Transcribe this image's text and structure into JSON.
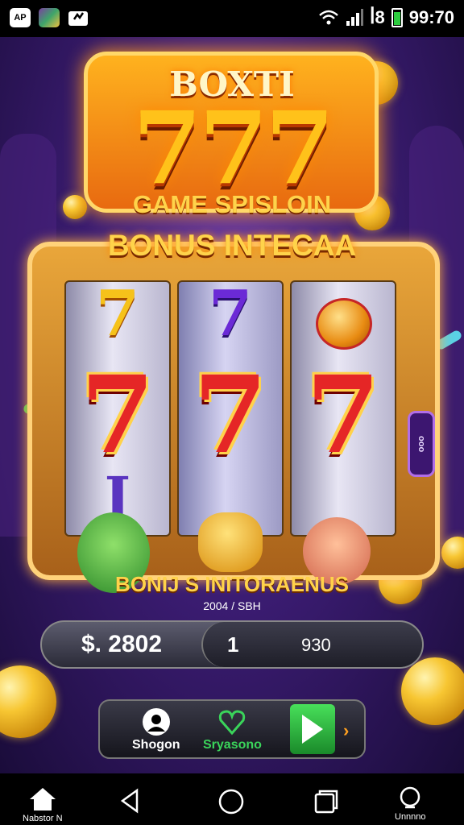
{
  "status_bar": {
    "badge": "AP",
    "time": "99:70",
    "signal_icons": [
      "wifi-icon",
      "signal-icon",
      "battery-icon"
    ],
    "network_text": "ꟾ8"
  },
  "game": {
    "title": "BOXTI",
    "big_number": "777",
    "subtitle": "GAME SPISLOIN",
    "bonus_title": "BONUS INTECAA",
    "side_pill": "ooo",
    "reels": [
      {
        "top": "7",
        "middle": "7",
        "bottom": "ꟾ"
      },
      {
        "top": "7",
        "middle": "7",
        "bottom": ""
      },
      {
        "top": "",
        "middle": "7",
        "bottom": ""
      }
    ],
    "bonus_caption": "BONIJ S INITORAENUS",
    "small_caption": "2004 / SBH",
    "balance": "$. 2802",
    "bet": "1",
    "win": "930",
    "buttons": {
      "left_label": "Shogon",
      "middle_label": "Sryasono"
    },
    "colors": {
      "accent_gold": "#ffc21a",
      "reel_red": "#e52626",
      "play_green": "#48e05a",
      "background_purple": "#3b1c72"
    }
  },
  "navbar": {
    "left_label": "Nabstor N",
    "right_label": "Unnnno",
    "icons": [
      "home-icon",
      "back-icon",
      "home-circle-icon",
      "recents-icon",
      "assistant-icon"
    ]
  }
}
